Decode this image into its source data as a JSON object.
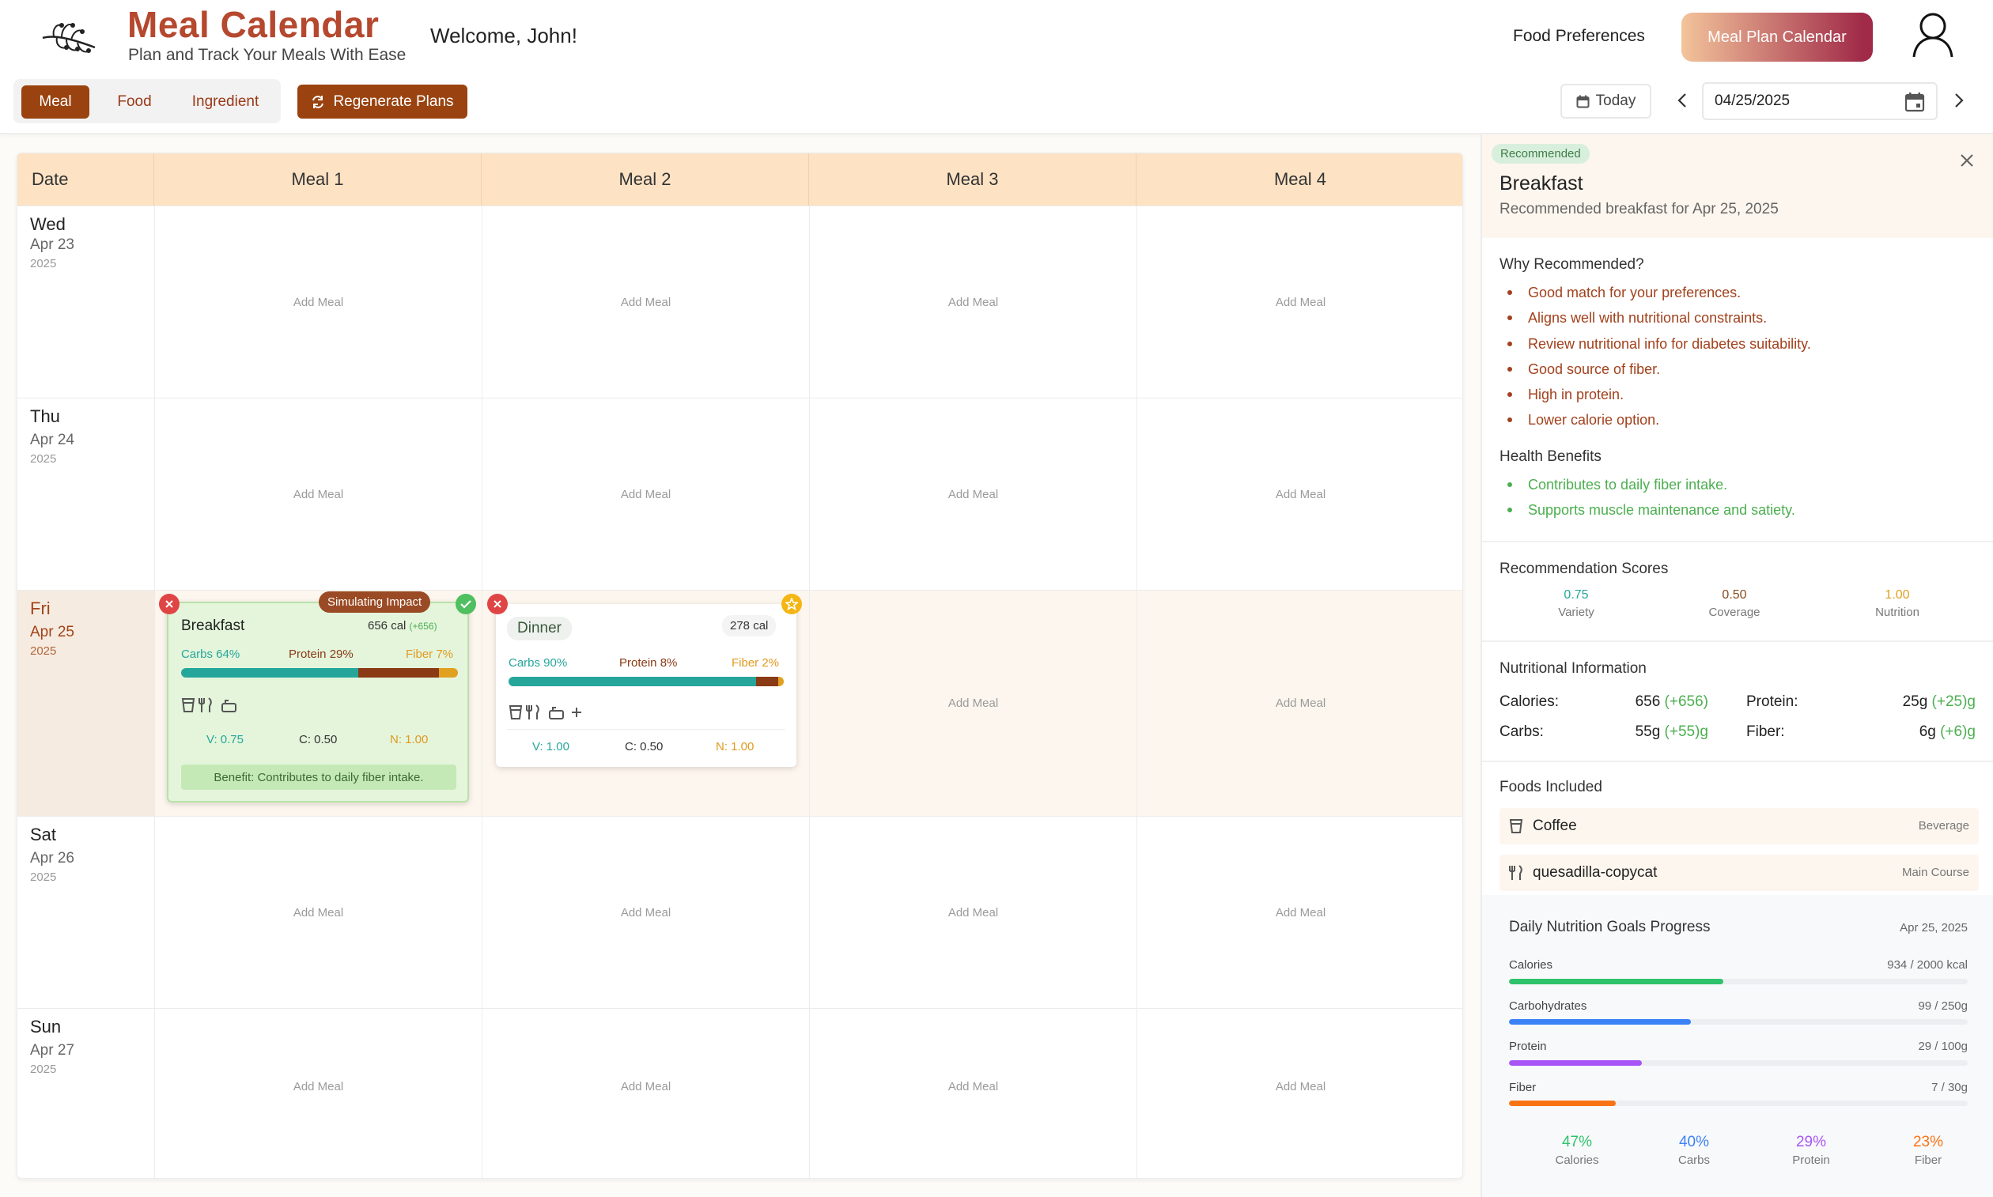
{
  "header": {
    "title": "Meal Calendar",
    "subtitle": "Plan and Track Your Meals With Ease",
    "welcome": "Welcome, John!",
    "nav_preferences": "Food Preferences",
    "nav_calendar": "Meal Plan Calendar"
  },
  "toolbar": {
    "tabs": [
      "Meal",
      "Food",
      "Ingredient"
    ],
    "active_tab": "Meal",
    "regenerate": "Regenerate Plans",
    "today": "Today",
    "date_value": "04/25/2025"
  },
  "grid": {
    "headers": [
      "Date",
      "Meal 1",
      "Meal 2",
      "Meal 3",
      "Meal 4"
    ],
    "add_meal": "Add Meal",
    "days": [
      {
        "name": "Wed",
        "date": "Apr 23",
        "year": "2025"
      },
      {
        "name": "Thu",
        "date": "Apr 24",
        "year": "2025"
      },
      {
        "name": "Fri",
        "date": "Apr 25",
        "year": "2025"
      },
      {
        "name": "Sat",
        "date": "Apr 26",
        "year": "2025"
      },
      {
        "name": "Sun",
        "date": "Apr 27",
        "year": "2025"
      }
    ]
  },
  "breakfast_card": {
    "tag": "Simulating Impact",
    "title": "Breakfast",
    "calories": "656 cal",
    "calories_delta": "(+656)",
    "carbs_label": "Carbs 64%",
    "protein_label": "Protein 29%",
    "fiber_label": "Fiber 7%",
    "carbs_pct": 64,
    "protein_pct": 29,
    "fiber_pct": 7,
    "score_v": "V: 0.75",
    "score_c": "C: 0.50",
    "score_n": "N: 1.00",
    "benefit": "Benefit: Contributes to daily fiber intake."
  },
  "dinner_card": {
    "title": "Dinner",
    "calories": "278 cal",
    "carbs_label": "Carbs 90%",
    "protein_label": "Protein 8%",
    "fiber_label": "Fiber 2%",
    "carbs_pct": 90,
    "protein_pct": 8,
    "fiber_pct": 2,
    "score_v": "V: 1.00",
    "score_c": "C: 0.50",
    "score_n": "N: 1.00"
  },
  "panel": {
    "badge": "Recommended",
    "title": "Breakfast",
    "subtitle": "Recommended breakfast for Apr 25, 2025",
    "why_title": "Why Recommended?",
    "why": [
      "Good match for your preferences.",
      "Aligns well with nutritional constraints.",
      "Review nutritional info for diabetes suitability.",
      "Good source of fiber.",
      "High in protein.",
      "Lower calorie option."
    ],
    "benefits_title": "Health Benefits",
    "benefits": [
      "Contributes to daily fiber intake.",
      "Supports muscle maintenance and satiety."
    ],
    "scores_title": "Recommendation Scores",
    "scores": [
      {
        "value": "0.75",
        "label": "Variety",
        "color": "#26a69a"
      },
      {
        "value": "0.50",
        "label": "Coverage",
        "color": "#8a4a1c"
      },
      {
        "value": "1.00",
        "label": "Nutrition",
        "color": "#e0a020"
      }
    ],
    "nutrition_title": "Nutritional Information",
    "nutrition": {
      "calories_label": "Calories:",
      "calories": "656",
      "calories_delta": "(+656)",
      "protein_label": "Protein:",
      "protein": "25g",
      "protein_delta": "(+25)g",
      "carbs_label": "Carbs:",
      "carbs": "55g",
      "carbs_delta": "(+55)g",
      "fiber_label": "Fiber:",
      "fiber": "6g",
      "fiber_delta": "(+6)g"
    },
    "foods_title": "Foods Included",
    "foods": [
      {
        "name": "Coffee",
        "type": "Beverage",
        "icon": "cup-icon"
      },
      {
        "name": "quesadilla-copycat",
        "type": "Main Course",
        "icon": "utensils-icon"
      }
    ],
    "goals": {
      "title": "Daily Nutrition Goals Progress",
      "date": "Apr 25, 2025",
      "items": [
        {
          "label": "Calories",
          "value": "934 / 2000 kcal",
          "fraction": 0.467,
          "color": "#2ec36a"
        },
        {
          "label": "Carbohydrates",
          "value": "99 / 250g",
          "fraction": 0.396,
          "color": "#3b82f6"
        },
        {
          "label": "Protein",
          "value": "29 / 100g",
          "fraction": 0.29,
          "color": "#a855f7"
        },
        {
          "label": "Fiber",
          "value": "7 / 30g",
          "fraction": 0.233,
          "color": "#f97316"
        }
      ],
      "percents": [
        {
          "value": "47%",
          "label": "Calories",
          "color": "#2ec36a"
        },
        {
          "value": "40%",
          "label": "Carbs",
          "color": "#3b82f6"
        },
        {
          "value": "29%",
          "label": "Protein",
          "color": "#a855f7"
        },
        {
          "value": "23%",
          "label": "Fiber",
          "color": "#f97316"
        }
      ]
    }
  }
}
